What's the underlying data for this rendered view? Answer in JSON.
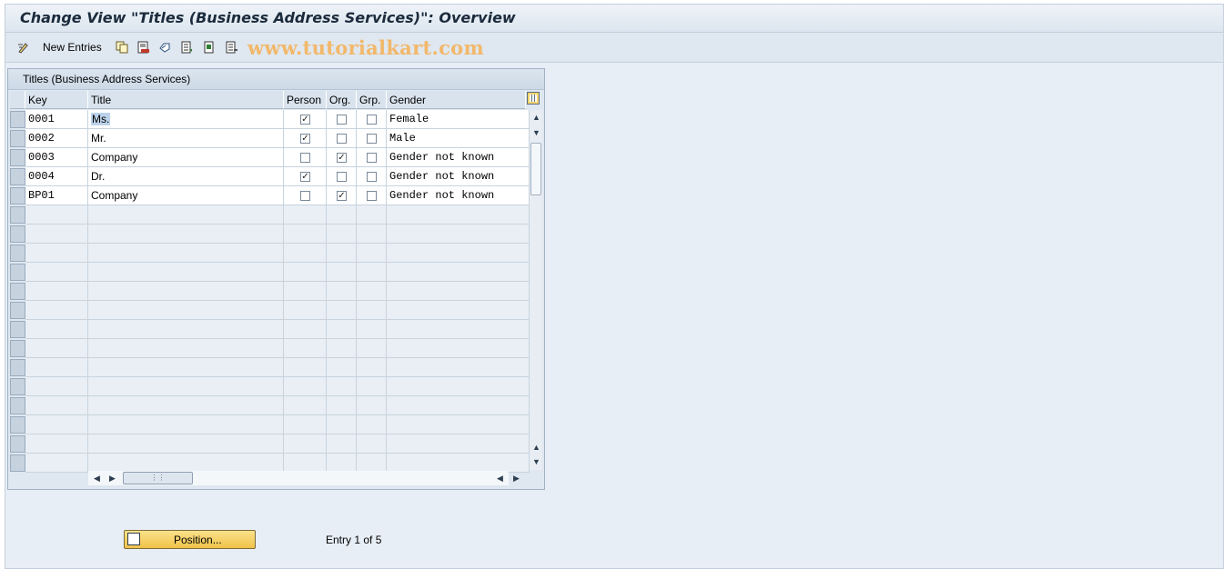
{
  "window": {
    "title": "Change View \"Titles (Business Address Services)\": Overview"
  },
  "toolbar": {
    "new_entries_label": "New Entries",
    "watermark": "www.tutorialkart.com",
    "icons": [
      "toggle-display-change-icon",
      "copy-as-icon",
      "delete-icon",
      "undo-change-icon",
      "select-all-icon",
      "select-block-icon",
      "deselect-all-icon"
    ]
  },
  "table": {
    "title": "Titles (Business Address Services)",
    "columns": [
      "Key",
      "Title",
      "Person",
      "Org.",
      "Grp.",
      "Gender"
    ],
    "rows": [
      {
        "key": "0001",
        "title": "Ms.",
        "person": true,
        "org": false,
        "grp": false,
        "gender": "Female"
      },
      {
        "key": "0002",
        "title": "Mr.",
        "person": true,
        "org": false,
        "grp": false,
        "gender": "Male"
      },
      {
        "key": "0003",
        "title": "Company",
        "person": false,
        "org": true,
        "grp": false,
        "gender": "Gender not known"
      },
      {
        "key": "0004",
        "title": "Dr.",
        "person": true,
        "org": false,
        "grp": false,
        "gender": "Gender not known"
      },
      {
        "key": "BP01",
        "title": "Company",
        "person": false,
        "org": true,
        "grp": false,
        "gender": "Gender not known"
      }
    ],
    "empty_row_count": 14
  },
  "footer": {
    "position_button_label": "Position...",
    "entry_info": "Entry 1 of 5"
  },
  "colors": {
    "accent_button": "#f0c24a",
    "background": "#e8eef5"
  }
}
